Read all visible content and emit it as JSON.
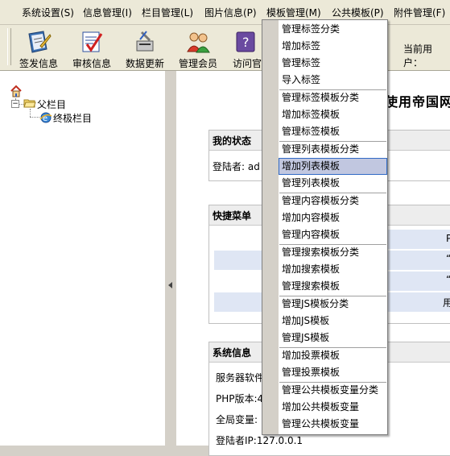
{
  "menubar": {
    "items": [
      {
        "label": "系统设置(S)"
      },
      {
        "label": "信息管理(I)"
      },
      {
        "label": "栏目管理(L)"
      },
      {
        "label": "图片信息(P)"
      },
      {
        "label": "模板管理(M)"
      },
      {
        "label": "公共模板(P)"
      },
      {
        "label": "附件管理(F)"
      }
    ]
  },
  "toolbar": {
    "buttons": [
      {
        "label": "签发信息",
        "icon": "sign-info-icon"
      },
      {
        "label": "审核信息",
        "icon": "check-info-icon"
      },
      {
        "label": "数据更新",
        "icon": "data-update-icon"
      },
      {
        "label": "管理会员",
        "icon": "members-icon"
      },
      {
        "label": "访问官",
        "icon": "visit-official-icon"
      }
    ],
    "current_user": "当前用户："
  },
  "tree": {
    "root": "父栏目",
    "child": "终极栏目"
  },
  "main": {
    "heading": "使用帝国网",
    "status": {
      "title": "我的状态",
      "login": "登陆者: ad"
    },
    "shortcuts": {
      "title": "快捷菜单",
      "cells": [
        "P",
        "“",
        "“",
        "用"
      ]
    },
    "sysinfo": {
      "title": "系统信息",
      "server": "服务器软件",
      "php": "PHP版本:4",
      "global": "全局变量: ",
      "ip": "登陆者IP:127.0.0.1"
    }
  },
  "dropdown": {
    "groups": [
      [
        "管理标签分类",
        "增加标签",
        "管理标签",
        "导入标签"
      ],
      [
        "管理标签模板分类",
        "增加标签模板",
        "管理标签模板"
      ],
      [
        "管理列表模板分类",
        "增加列表模板",
        "管理列表模板"
      ],
      [
        "管理内容模板分类",
        "增加内容模板",
        "管理内容模板"
      ],
      [
        "管理搜索模板分类",
        "增加搜索模板",
        "管理搜索模板"
      ],
      [
        "管理JS模板分类",
        "增加JS模板",
        "管理JS模板"
      ],
      [
        "增加投票模板",
        "管理投票模板"
      ],
      [
        "管理公共模板变量分类",
        "增加公共模板变量",
        "管理公共模板变量"
      ]
    ],
    "highlighted": "增加列表模板"
  }
}
